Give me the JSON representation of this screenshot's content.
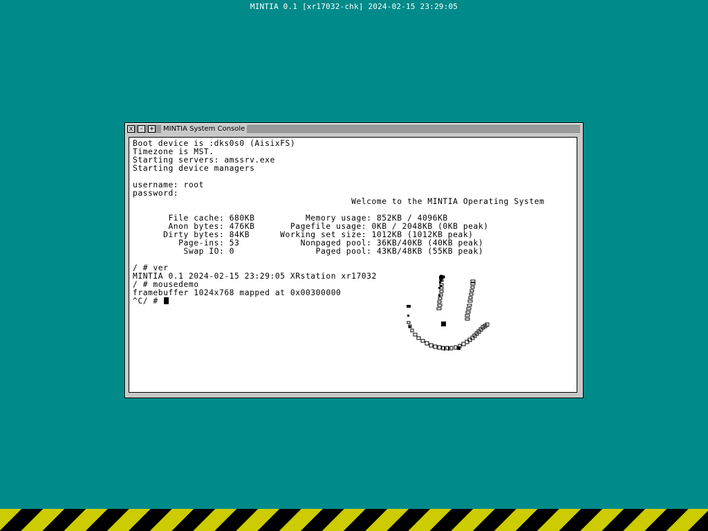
{
  "top_status": "MINTIA 0.1 [xr17032-chk] 2024-02-15 23:29:05",
  "window": {
    "title": "MINTIA System Console",
    "close_label": "x",
    "minimize_label": "-",
    "maximize_label": "+"
  },
  "console": {
    "lines": [
      "Boot device is :dks0s0 (AisixFS)",
      "Timezone is MST.",
      "Starting servers: amssrv.exe",
      "Starting device managers",
      "",
      "username: root",
      "password:",
      "                                           Welcome to the MINTIA Operating System",
      "",
      "       File cache: 680KB          Memory usage: 852KB / 4096KB",
      "       Anon bytes: 476KB       Pagefile usage: 0KB / 2048KB (0KB peak)",
      "      Dirty bytes: 84KB      Working set size: 1012KB (1012KB peak)",
      "         Page-ins: 53            Nonpaged pool: 36KB/40KB (40KB peak)",
      "          Swap IO: 0                Paged pool: 43KB/48KB (55KB peak)",
      "",
      "/ # ver",
      "MINTIA 0.1 2024-02-15 23:29:05 XRstation xr17032",
      "/ # mousedemo",
      "framebuffer 1024x768 mapped at 0x00300000"
    ],
    "prompt": "^C/ # "
  }
}
